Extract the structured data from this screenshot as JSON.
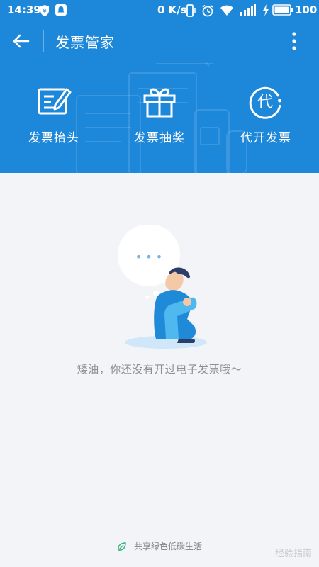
{
  "status_bar": {
    "time": "14:39",
    "speed": "0 K/s",
    "battery": "100",
    "icons": [
      "yen-shield-icon",
      "bell-icon",
      "vibrate-icon",
      "alarm-icon",
      "wifi-icon",
      "signal-icon",
      "charging-icon",
      "battery-icon"
    ]
  },
  "header": {
    "title": "发票管家",
    "background_color": "#1d87d9",
    "actions": [
      {
        "label": "发票抬头",
        "icon": "edit-note-icon"
      },
      {
        "label": "发票抽奖",
        "icon": "gift-icon"
      },
      {
        "label": "代开发票",
        "icon": "dai-circle-icon",
        "icon_glyph": "代"
      }
    ]
  },
  "empty_state": {
    "message": "矮油，你还没有开过电子发票哦～",
    "bubble_text": "• • •"
  },
  "footer": {
    "text": "共享绿色低碳生活",
    "icon": "leaf-icon"
  },
  "watermark": "经验指南"
}
